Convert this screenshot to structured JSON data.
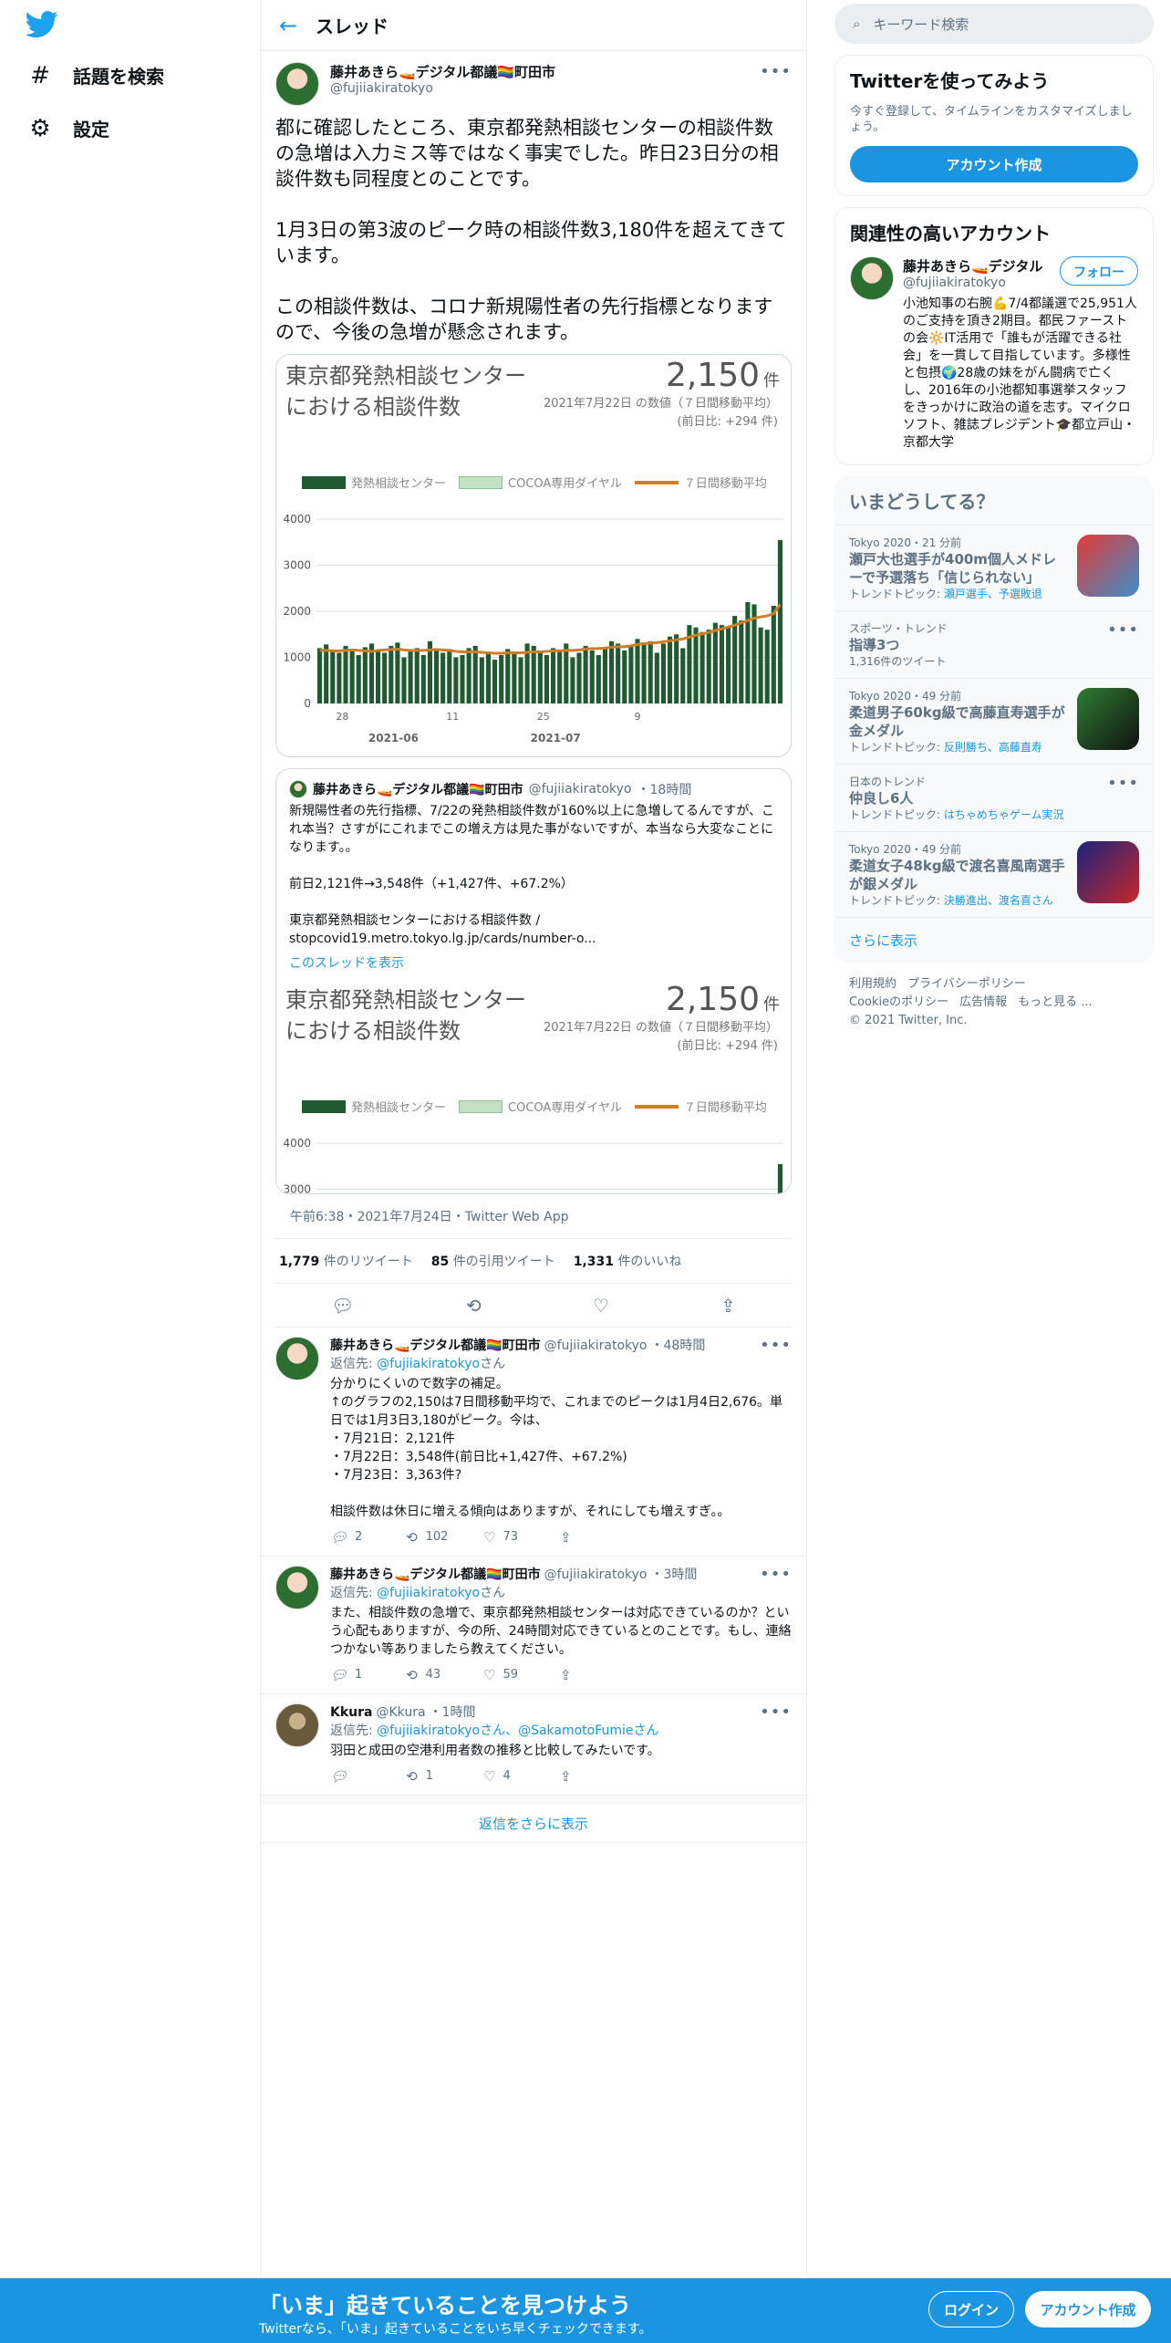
{
  "nav": {
    "items": [
      {
        "label": "話題を検索",
        "icon": "hashtag-icon"
      },
      {
        "label": "設定",
        "icon": "gear-icon"
      }
    ]
  },
  "header": {
    "title": "スレッド"
  },
  "tweet": {
    "author_name": "藤井あきら🚤デジタル都議🏳️‍🌈町田市",
    "author_handle": "@fujiiakiratokyo",
    "text": "都に確認したところ、東京都発熱相談センターの相談件数の急増は入力ミス等ではなく事実でした。昨日23日分の相談件数も同程度とのことです。\n\n1月3日の第3波のピーク時の相談件数3,180件を超えてきています。\n\nこの相談件数は、コロナ新規陽性者の先行指標となりますので、今後の急増が懸念されます。",
    "timestamp": "午前6:38・2021年7月24日・Twitter Web App",
    "retweets": "1,779",
    "retweets_label": "件のリツイート",
    "quotes": "85",
    "quotes_label": "件の引用ツイート",
    "likes": "1,331",
    "likes_label": "件のいいね"
  },
  "chart_card": {
    "title_line1": "東京都発熱相談センター",
    "title_line2": "における相談件数",
    "big_number": "2,150",
    "unit": "件",
    "date_line": "2021年7月22日 の数値（７日間移動平均）",
    "diff_line": "(前日比: +294 件)"
  },
  "chart_data": {
    "type": "bar",
    "legend": [
      "発熱相談センター",
      "COCOA専用ダイヤル",
      "７日間移動平均"
    ],
    "colors": {
      "bars": "#1f5a30",
      "cocoa": "#c2e2c4",
      "avg": "#d07d25"
    },
    "yticks": [
      "0",
      "1000",
      "2000",
      "3000",
      "4000"
    ],
    "ylim": [
      0,
      4000
    ],
    "xtick_labels": [
      "28",
      "11",
      "25",
      "9"
    ],
    "month_labels": [
      "2021-06",
      "2021-07"
    ],
    "values": [
      1200,
      1280,
      1150,
      1100,
      1250,
      1180,
      1050,
      1220,
      1300,
      1150,
      1100,
      1250,
      1320,
      1000,
      1150,
      1200,
      1050,
      1350,
      1150,
      1100,
      1180,
      1000,
      1050,
      1200,
      1250,
      1000,
      1100,
      950,
      1050,
      1180,
      1120,
      1000,
      1300,
      1250,
      1100,
      1050,
      1200,
      1150,
      1300,
      1000,
      1100,
      1250,
      1150,
      1050,
      1200,
      1350,
      1300,
      1150,
      1250,
      1400,
      1300,
      1350,
      1100,
      1300,
      1450,
      1500,
      1200,
      1700,
      1650,
      1550,
      1600,
      1750,
      1700,
      1650,
      1900,
      1800,
      2200,
      2150,
      1650,
      1600,
      2121,
      3548
    ],
    "avg": [
      1150,
      1150,
      1140,
      1140,
      1150,
      1160,
      1150,
      1140,
      1130,
      1150,
      1160,
      1170,
      1180,
      1160,
      1150,
      1150,
      1150,
      1160,
      1170,
      1160,
      1150,
      1130,
      1120,
      1120,
      1120,
      1110,
      1100,
      1090,
      1090,
      1100,
      1100,
      1100,
      1110,
      1120,
      1120,
      1130,
      1140,
      1140,
      1150,
      1150,
      1160,
      1180,
      1190,
      1190,
      1200,
      1220,
      1230,
      1230,
      1250,
      1280,
      1300,
      1310,
      1320,
      1340,
      1360,
      1380,
      1400,
      1440,
      1480,
      1510,
      1540,
      1580,
      1620,
      1660,
      1700,
      1750,
      1800,
      1850,
      1880,
      1900,
      1950,
      2150
    ]
  },
  "quote": {
    "author_name": "藤井あきら🚤デジタル都議🏳️‍🌈町田市",
    "author_handle": "@fujiiakiratokyo",
    "time": "・18時間",
    "text": "新規陽性者の先行指標、7/22の発熱相談件数が160%以上に急増してるんですが、これ本当？さすがにこれまでこの増え方は見た事がないですが、本当なら大変なことになります。。\n\n前日2,121件→3,548件（+1,427件、+67.2%）\n\n東京都発熱相談センターにおける相談件数 /\nstopcovid19.metro.tokyo.lg.jp/cards/number-o...",
    "show_thread": "このスレッドを表示"
  },
  "replies": [
    {
      "name": "藤井あきら🚤デジタル都議🏳️‍🌈町田市",
      "handle": "@fujiiakiratokyo",
      "time": "・48時間",
      "to_prefix": "返信先: ",
      "to": "@fujiiakiratokyo",
      "to_suffix": "さん",
      "text": "分かりにくいので数字の補足。\n↑のグラフの2,150は7日間移動平均で、これまでのピークは1月4日2,676。単日では1月3日3,180がピーク。今は、\n・7月21日：2,121件\n・7月22日：3,548件(前日比+1,427件、+67.2%)\n・7月23日：3,363件?\n\n相談件数は休日に増える傾向はありますが、それにしても増えすぎ。。",
      "replies": "2",
      "retweets": "102",
      "likes": "73"
    },
    {
      "name": "藤井あきら🚤デジタル都議🏳️‍🌈町田市",
      "handle": "@fujiiakiratokyo",
      "time": "・3時間",
      "to_prefix": "返信先: ",
      "to": "@fujiiakiratokyo",
      "to_suffix": "さん",
      "text": "また、相談件数の急増で、東京都発熱相談センターは対応できているのか？という心配もありますが、今の所、24時間対応できているとのことです。もし、連絡つかない等ありましたら教えてください。",
      "replies": "1",
      "retweets": "43",
      "likes": "59"
    },
    {
      "name": "Kkura",
      "handle": "@Kkura",
      "time": "・1時間",
      "to_prefix": "返信先: ",
      "to": "@fujiiakiratokyoさん、@SakamotoFumieさん",
      "to_suffix": "",
      "text": "羽田と成田の空港利用者数の推移と比較してみたいです。",
      "replies": "",
      "retweets": "1",
      "likes": "4"
    }
  ],
  "more_replies": "返信をさらに表示",
  "right": {
    "search_placeholder": "キーワード検索",
    "try": {
      "title": "Twitterを使ってみよう",
      "sub": "今すぐ登録して、タイムラインをカスタマイズしましょう。",
      "button": "アカウント作成"
    },
    "related": {
      "title": "関連性の高いアカウント",
      "name": "藤井あきら🚤デジタル",
      "handle": "@fujiiakiratokyo",
      "follow": "フォロー",
      "bio": "小池知事の右腕💪7/4都議選で25,951人のご支持を頂き2期目。都民ファーストの会🔆IT活用で「誰もが活躍できる社会」を一貫して目指しています。多様性と包摂🌍28歳の妹をがん闘病で亡くし、2016年の小池都知事選挙スタッフをきっかけに政治の道を志す。マイクロソフト、雑誌プレジデント🎓都立戸山・京都大学"
    },
    "trends_title": "いまどうしてる？",
    "trends": [
      {
        "meta": "Tokyo 2020・21 分前",
        "title": "瀬戸大也選手が400m個人メドレーで予選落ち「信じられない」",
        "topic_prefix": "トレンドトピック: ",
        "topic": "瀬戸選手、予選敗退",
        "thumb": "#3b8fc9"
      },
      {
        "meta": "スポーツ・トレンド",
        "title": "指導3つ",
        "topic_prefix": "",
        "topic": "1,316件のツイート",
        "thumb": ""
      },
      {
        "meta": "Tokyo 2020・49 分前",
        "title": "柔道男子60kg級で高藤直寿選手が金メダル",
        "topic_prefix": "トレンドトピック: ",
        "topic": "反則勝ち、高藤直寿",
        "thumb": "#2e7d32"
      },
      {
        "meta": "日本のトレンド",
        "title": "仲良し6人",
        "topic_prefix": "トレンドトピック: ",
        "topic": "はちゃめちゃゲーム実況",
        "thumb": ""
      },
      {
        "meta": "Tokyo 2020・49 分前",
        "title": "柔道女子48kg級で渡名喜風南選手が銀メダル",
        "topic_prefix": "トレンドトピック: ",
        "topic": "決勝進出、渡名喜さん",
        "thumb": "#1a237e"
      }
    ],
    "show_more": "さらに表示",
    "footer": [
      "利用規約",
      "プライバシーポリシー",
      "Cookieのポリシー",
      "広告情報",
      "もっと見る ...",
      "© 2021 Twitter, Inc."
    ]
  },
  "bottom": {
    "title": "「いま」起きていることを見つけよう",
    "sub": "Twitterなら、「いま」起きていることをいち早くチェックできます。",
    "login": "ログイン",
    "signup": "アカウント作成"
  }
}
